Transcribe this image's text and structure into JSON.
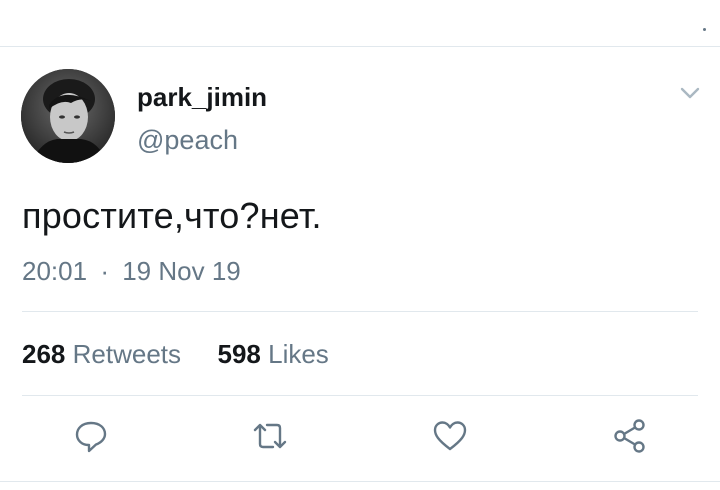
{
  "tweet": {
    "display_name": "park_jimin",
    "handle": "@peach",
    "text": "простите,что?нет.",
    "time": "20:01",
    "separator": "·",
    "date": "19 Nov 19"
  },
  "stats": {
    "retweets_count": "268",
    "retweets_label": "Retweets",
    "likes_count": "598",
    "likes_label": "Likes"
  },
  "icons": {
    "menu": "chevron-down-icon",
    "reply": "reply-icon",
    "retweet": "retweet-icon",
    "like": "heart-icon",
    "share": "share-icon"
  },
  "colors": {
    "text": "#14171a",
    "secondary": "#657786",
    "divider": "#e1e8ed",
    "icon": "#657786"
  }
}
